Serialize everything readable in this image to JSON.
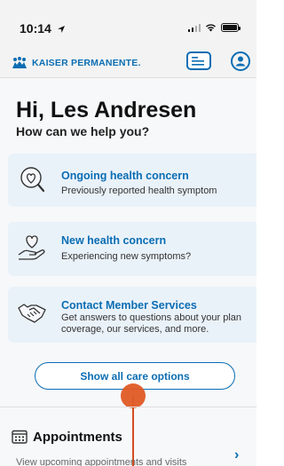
{
  "status_bar": {
    "time": "10:14",
    "location_icon": "location-arrow-icon",
    "signal_icon": "cellular-signal-icon",
    "wifi_icon": "wifi-icon",
    "battery_icon": "battery-icon"
  },
  "header": {
    "brand": "KAISER PERMANENTE.",
    "brand_icon": "kaiser-logo-icon",
    "card_icon": "member-card-icon",
    "account_icon": "account-icon"
  },
  "main": {
    "greeting": "Hi, Les Andresen",
    "subheading": "How can we help you?",
    "cards": [
      {
        "title": "Ongoing health concern",
        "description": "Previously reported health symptom",
        "icon": "magnifier-heart-icon"
      },
      {
        "title": "New health concern",
        "description": "Experiencing new symptoms?",
        "icon": "hand-heart-icon"
      },
      {
        "title": "Contact Member Services",
        "description": "Get answers to questions about your plan coverage, our services, and more.",
        "icon": "handshake-icon"
      }
    ],
    "show_all_label": "Show all care options"
  },
  "appointments": {
    "title": "Appointments",
    "description": "View upcoming appointments and visits",
    "icon": "calendar-icon",
    "chevron": "›"
  },
  "colors": {
    "brand_blue": "#0b6db3",
    "card_bg": "#eaf2f9",
    "tap_indicator": "#e05a24"
  }
}
